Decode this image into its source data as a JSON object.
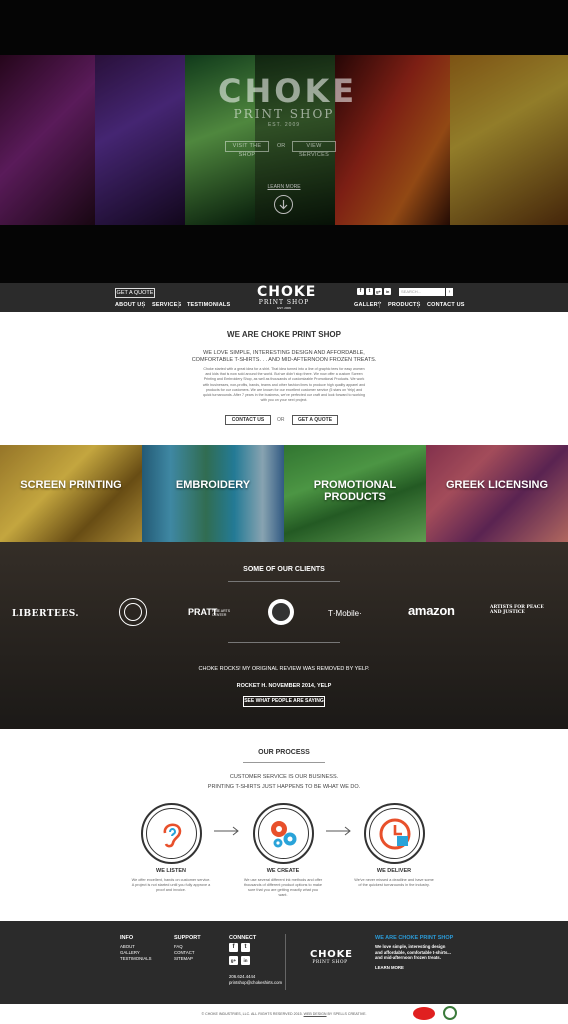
{
  "hero": {
    "logo_main": "CHOKE",
    "logo_sub": "PRINT SHOP",
    "logo_est": "EST. 2009",
    "btn_shop": "VISIT THE SHOP",
    "or": "OR",
    "btn_services": "VIEW SERVICES",
    "learn_more": "LEARN MORE",
    "arrow_icon": "arrow-down-circle-icon"
  },
  "nav": {
    "get_quote": "GET A QUOTE",
    "left_links": [
      "ABOUT US",
      "SERVICES",
      "TESTIMONIALS"
    ],
    "right_links": [
      "GALLERY",
      "PRODUCTS",
      "CONTACT US"
    ],
    "logo_main": "CHOKE",
    "logo_sub": "PRINT SHOP",
    "logo_small": "EST. 2009",
    "social": [
      "f",
      "t",
      "g+",
      "in"
    ],
    "search_placeholder": "SEARCH...",
    "search_go": "›"
  },
  "intro": {
    "title": "WE ARE CHOKE PRINT SHOP",
    "sub1": "WE LOVE SIMPLE, INTERESTING DESIGN AND AFFORDABLE,",
    "sub2": "COMFORTABLE T-SHIRTS. . . AND MID-AFTERNOON FROZEN TREATS.",
    "body": "Choke started with a great idea for a shirt. That idea turned into a line of graphic tees for easy women and kids that is now sold around the world. But we didn't stop there. We now offer a custom Screen Printing and Embroidery Shop, as well as thousands of customizable Promotional Products. We work with businesses, non-profits, bands, teams and other fashion lines to produce high quality apparel and products for our customers. We are known for our excellent customer service (5 stars on Yelp) and quick turnarounds. After 7 years in the business, we've perfected our craft and look forward to working with you on your next project.",
    "btn_contact": "CONTACT US",
    "or": "OR",
    "btn_quote": "GET A QUOTE"
  },
  "services": [
    {
      "label1": "SCREEN PRINTING",
      "label2": ""
    },
    {
      "label1": "EMBROIDERY",
      "label2": ""
    },
    {
      "label1": "PROMOTIONAL",
      "label2": "PRODUCTS"
    },
    {
      "label1": "GREEK LICENSING",
      "label2": ""
    }
  ],
  "clients": {
    "title": "SOME OF OUR CLIENTS",
    "logos": [
      "LIBERTEES.",
      "PRATT",
      "FINE ARTS CENTER",
      "T·Mobile·",
      "amazon",
      "ARTISTS FOR PEACE AND JUSTICE"
    ],
    "quote": "CHOKE ROCKS! MY ORIGINAL REVIEW WAS REMOVED BY YELP.",
    "author": "ROCKET H. NOVEMBER 2014, YELP",
    "btn": "SEE WHAT PEOPLE ARE SAYING"
  },
  "process": {
    "title": "OUR PROCESS",
    "sub1": "CUSTOMER SERVICE IS OUR BUSINESS.",
    "sub2": "PRINTING T-SHIRTS JUST HAPPENS TO BE WHAT WE DO.",
    "steps": [
      {
        "icon": "ear-icon",
        "title": "WE LISTEN",
        "body": "We offer excellent, hands on customer service. A project is not started until you fully approve a proof and invoice."
      },
      {
        "icon": "gears-icon",
        "title": "WE CREATE",
        "body": "We use several different ink methods and offer thousands of different product options to make sure that you are getting exactly what you want."
      },
      {
        "icon": "clock-calendar-icon",
        "title": "WE DELIVER",
        "body": "We've never missed a deadline and have some of the quickest turnarounds in the industry."
      }
    ],
    "accent": "#e8502b"
  },
  "footer": {
    "info_title": "INFO",
    "info_links": [
      "ABOUT",
      "GALLERY",
      "TESTIMONIALS"
    ],
    "support_title": "SUPPORT",
    "support_links": [
      "FAQ",
      "CONTACT",
      "SITEMAP"
    ],
    "connect_title": "CONNECT",
    "phone": "206.624.4444",
    "email": "printshop@chokeshirts.com",
    "logo_main": "CHOKE",
    "logo_sub": "PRINT SHOP",
    "about_title": "WE ARE CHOKE PRINT SHOP",
    "about_body": "We love simple, interesting design and affordable, comfortable t-shirts... and mid-afternoon frozen treats.",
    "learn_more": "LEARN MORE",
    "accent": "#2b9bd8",
    "copyright_pre": "© CHOKE INDUSTRIES, LLC. ALL RIGHTS RESERVED 2015.",
    "copyright_link": "WEB DESIGN",
    "copyright_post": "BY SPELLS CREATIVE."
  }
}
